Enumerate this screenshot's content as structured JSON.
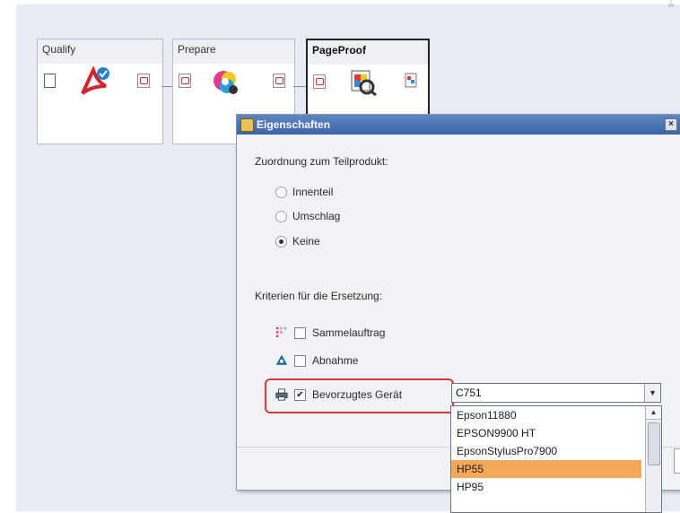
{
  "workflow": {
    "nodes": [
      {
        "title": "Qualify"
      },
      {
        "title": "Prepare"
      },
      {
        "title": "PageProof"
      }
    ]
  },
  "dialog": {
    "title": "Eigenschaften",
    "close_glyph": "×",
    "assignment_label": "Zuordnung zum Teilprodukt:",
    "assignment_options": [
      {
        "label": "Innenteil",
        "checked": false
      },
      {
        "label": "Umschlag",
        "checked": false
      },
      {
        "label": "Keine",
        "checked": true
      }
    ],
    "criteria_label": "Kriterien für die Ersetzung:",
    "criteria": [
      {
        "label": "Sammelauftrag",
        "checked": false,
        "icon": "collection-icon"
      },
      {
        "label": "Abnahme",
        "checked": false,
        "icon": "approval-icon"
      },
      {
        "label": "Bevorzugtes Gerät",
        "checked": true,
        "icon": "printer-icon"
      }
    ],
    "device_select": {
      "value": "C751",
      "options": [
        "Epson11880",
        "EPSON9900 HT",
        "EpsonStylusPro7900",
        "HP55",
        "HP95"
      ],
      "highlighted": "HP55"
    }
  },
  "colors": {
    "accent_highlight": "#d23a3a",
    "selection": "#f4a857",
    "titlebar": "#3b64a6"
  }
}
